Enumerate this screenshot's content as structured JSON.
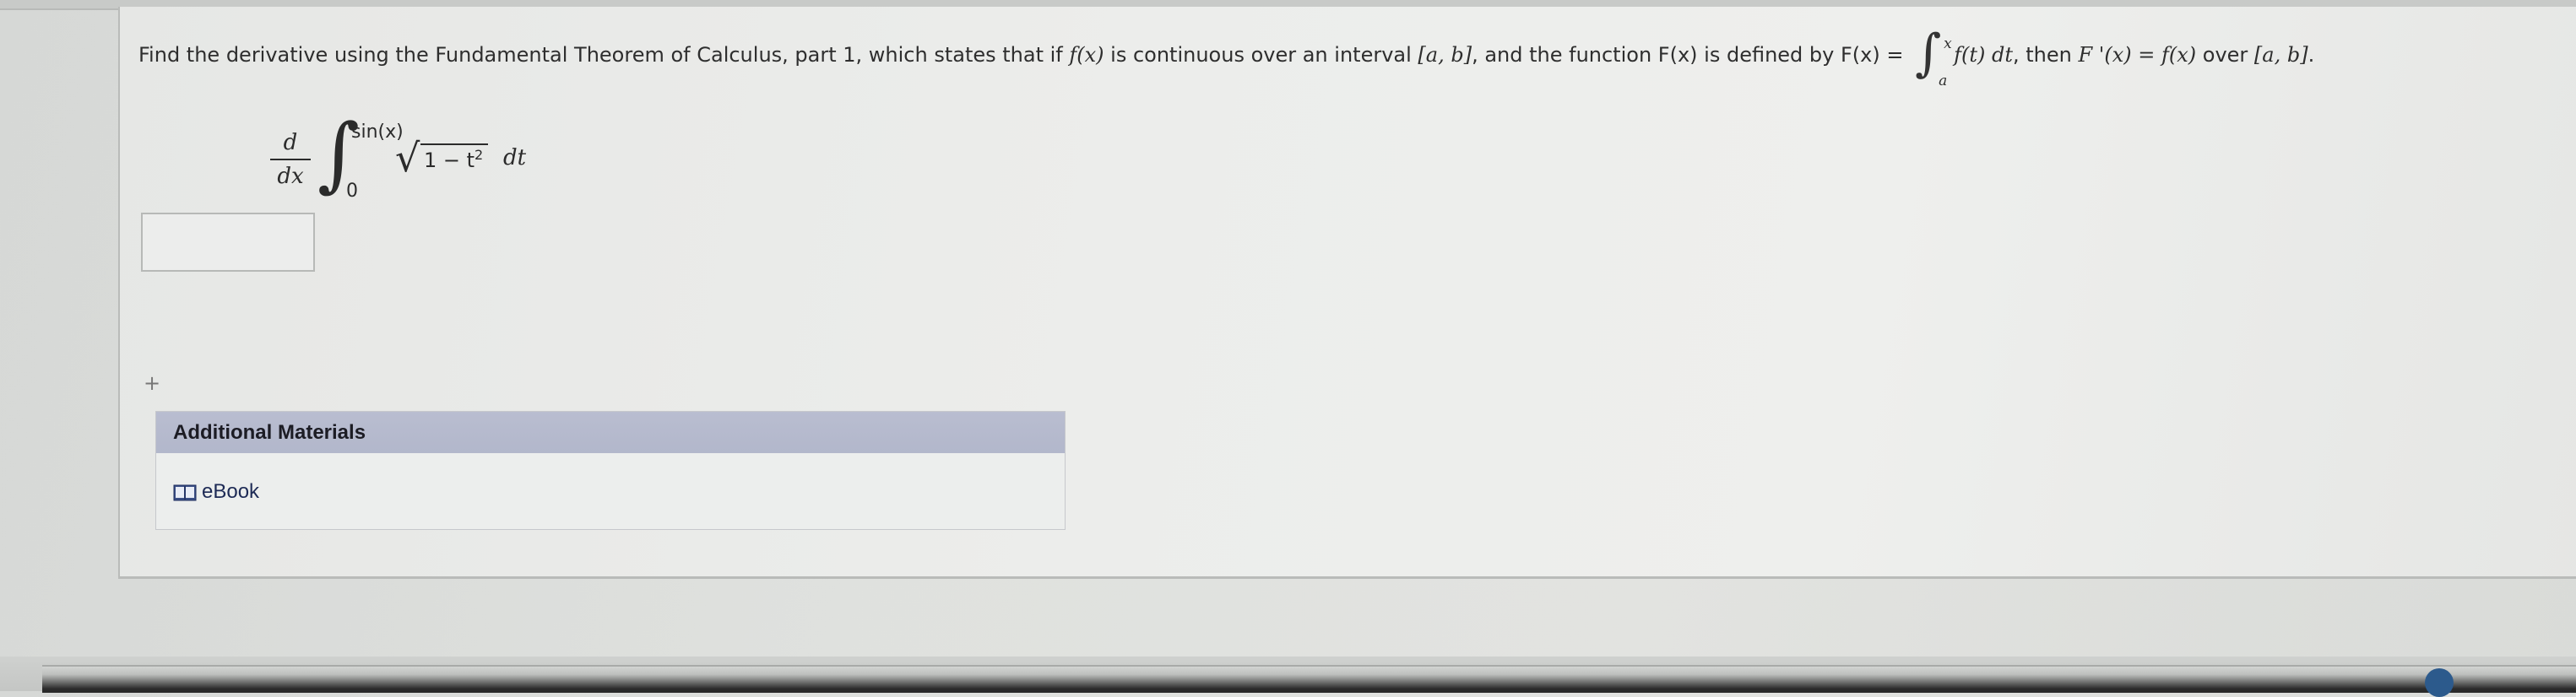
{
  "question": {
    "intro": "Find the derivative using the Fundamental Theorem of Calculus, part 1, which states that if ",
    "fx": "f(x)",
    "mid1": " is continuous over an interval ",
    "interval": "[a, b]",
    "mid2": ", and the function ",
    "Fx": "F(x)",
    "mid3": " is defined by ",
    "Fx_eq": "F(x) =",
    "int_upper": "x",
    "int_lower": "a",
    "integrand": "f(t) dt",
    "mid4": ", then ",
    "Fprime": "F '(x) = f(x)",
    "mid5": " over ",
    "interval2": "[a, b]",
    "end": "."
  },
  "problem": {
    "d_num": "d",
    "d_den": "dx",
    "upper_limit": "sin(x)",
    "lower_limit": "0",
    "radicand_base": "1 − t",
    "radicand_exp": "2",
    "differential": "dt"
  },
  "answer": {
    "value": ""
  },
  "plus_symbol": "+",
  "materials": {
    "header": "Additional Materials",
    "ebook_label": "eBook"
  }
}
